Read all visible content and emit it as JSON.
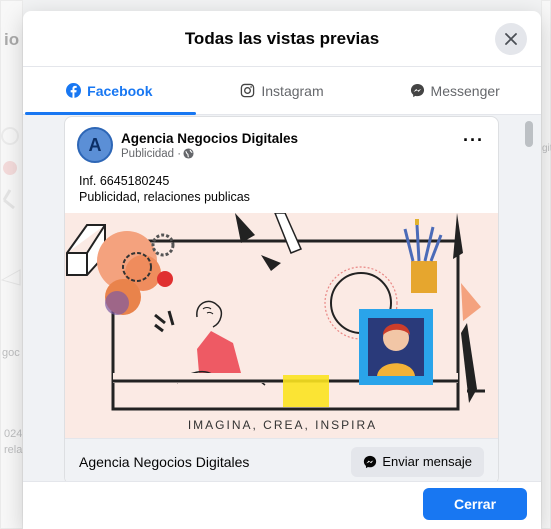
{
  "background": {
    "frag1": "io",
    "frag2": "goc",
    "frag3": "024",
    "frag4": "rela",
    "frag5": "git"
  },
  "modal": {
    "title": "Todas las vistas previas",
    "close_icon": "close-icon",
    "tabs": [
      {
        "label": "Facebook",
        "icon": "facebook-icon",
        "active": true
      },
      {
        "label": "Instagram",
        "icon": "instagram-icon",
        "active": false
      },
      {
        "label": "Messenger",
        "icon": "messenger-icon",
        "active": false
      }
    ],
    "close_button": "Cerrar"
  },
  "post": {
    "avatar_letter": "A",
    "page_name": "Agencia Negocios Digitales",
    "sponsored": "Publicidad ·",
    "text_line1": "Inf. 6645180245",
    "text_line2": "Publicidad, relaciones publicas",
    "image_tagline": "IMAGINA, CREA, INSPIRA",
    "footer_name": "Agencia Negocios Digitales",
    "cta_label": "Enviar mensaje"
  },
  "colors": {
    "accent": "#1877f2",
    "image_bg": "#fbeae4"
  }
}
